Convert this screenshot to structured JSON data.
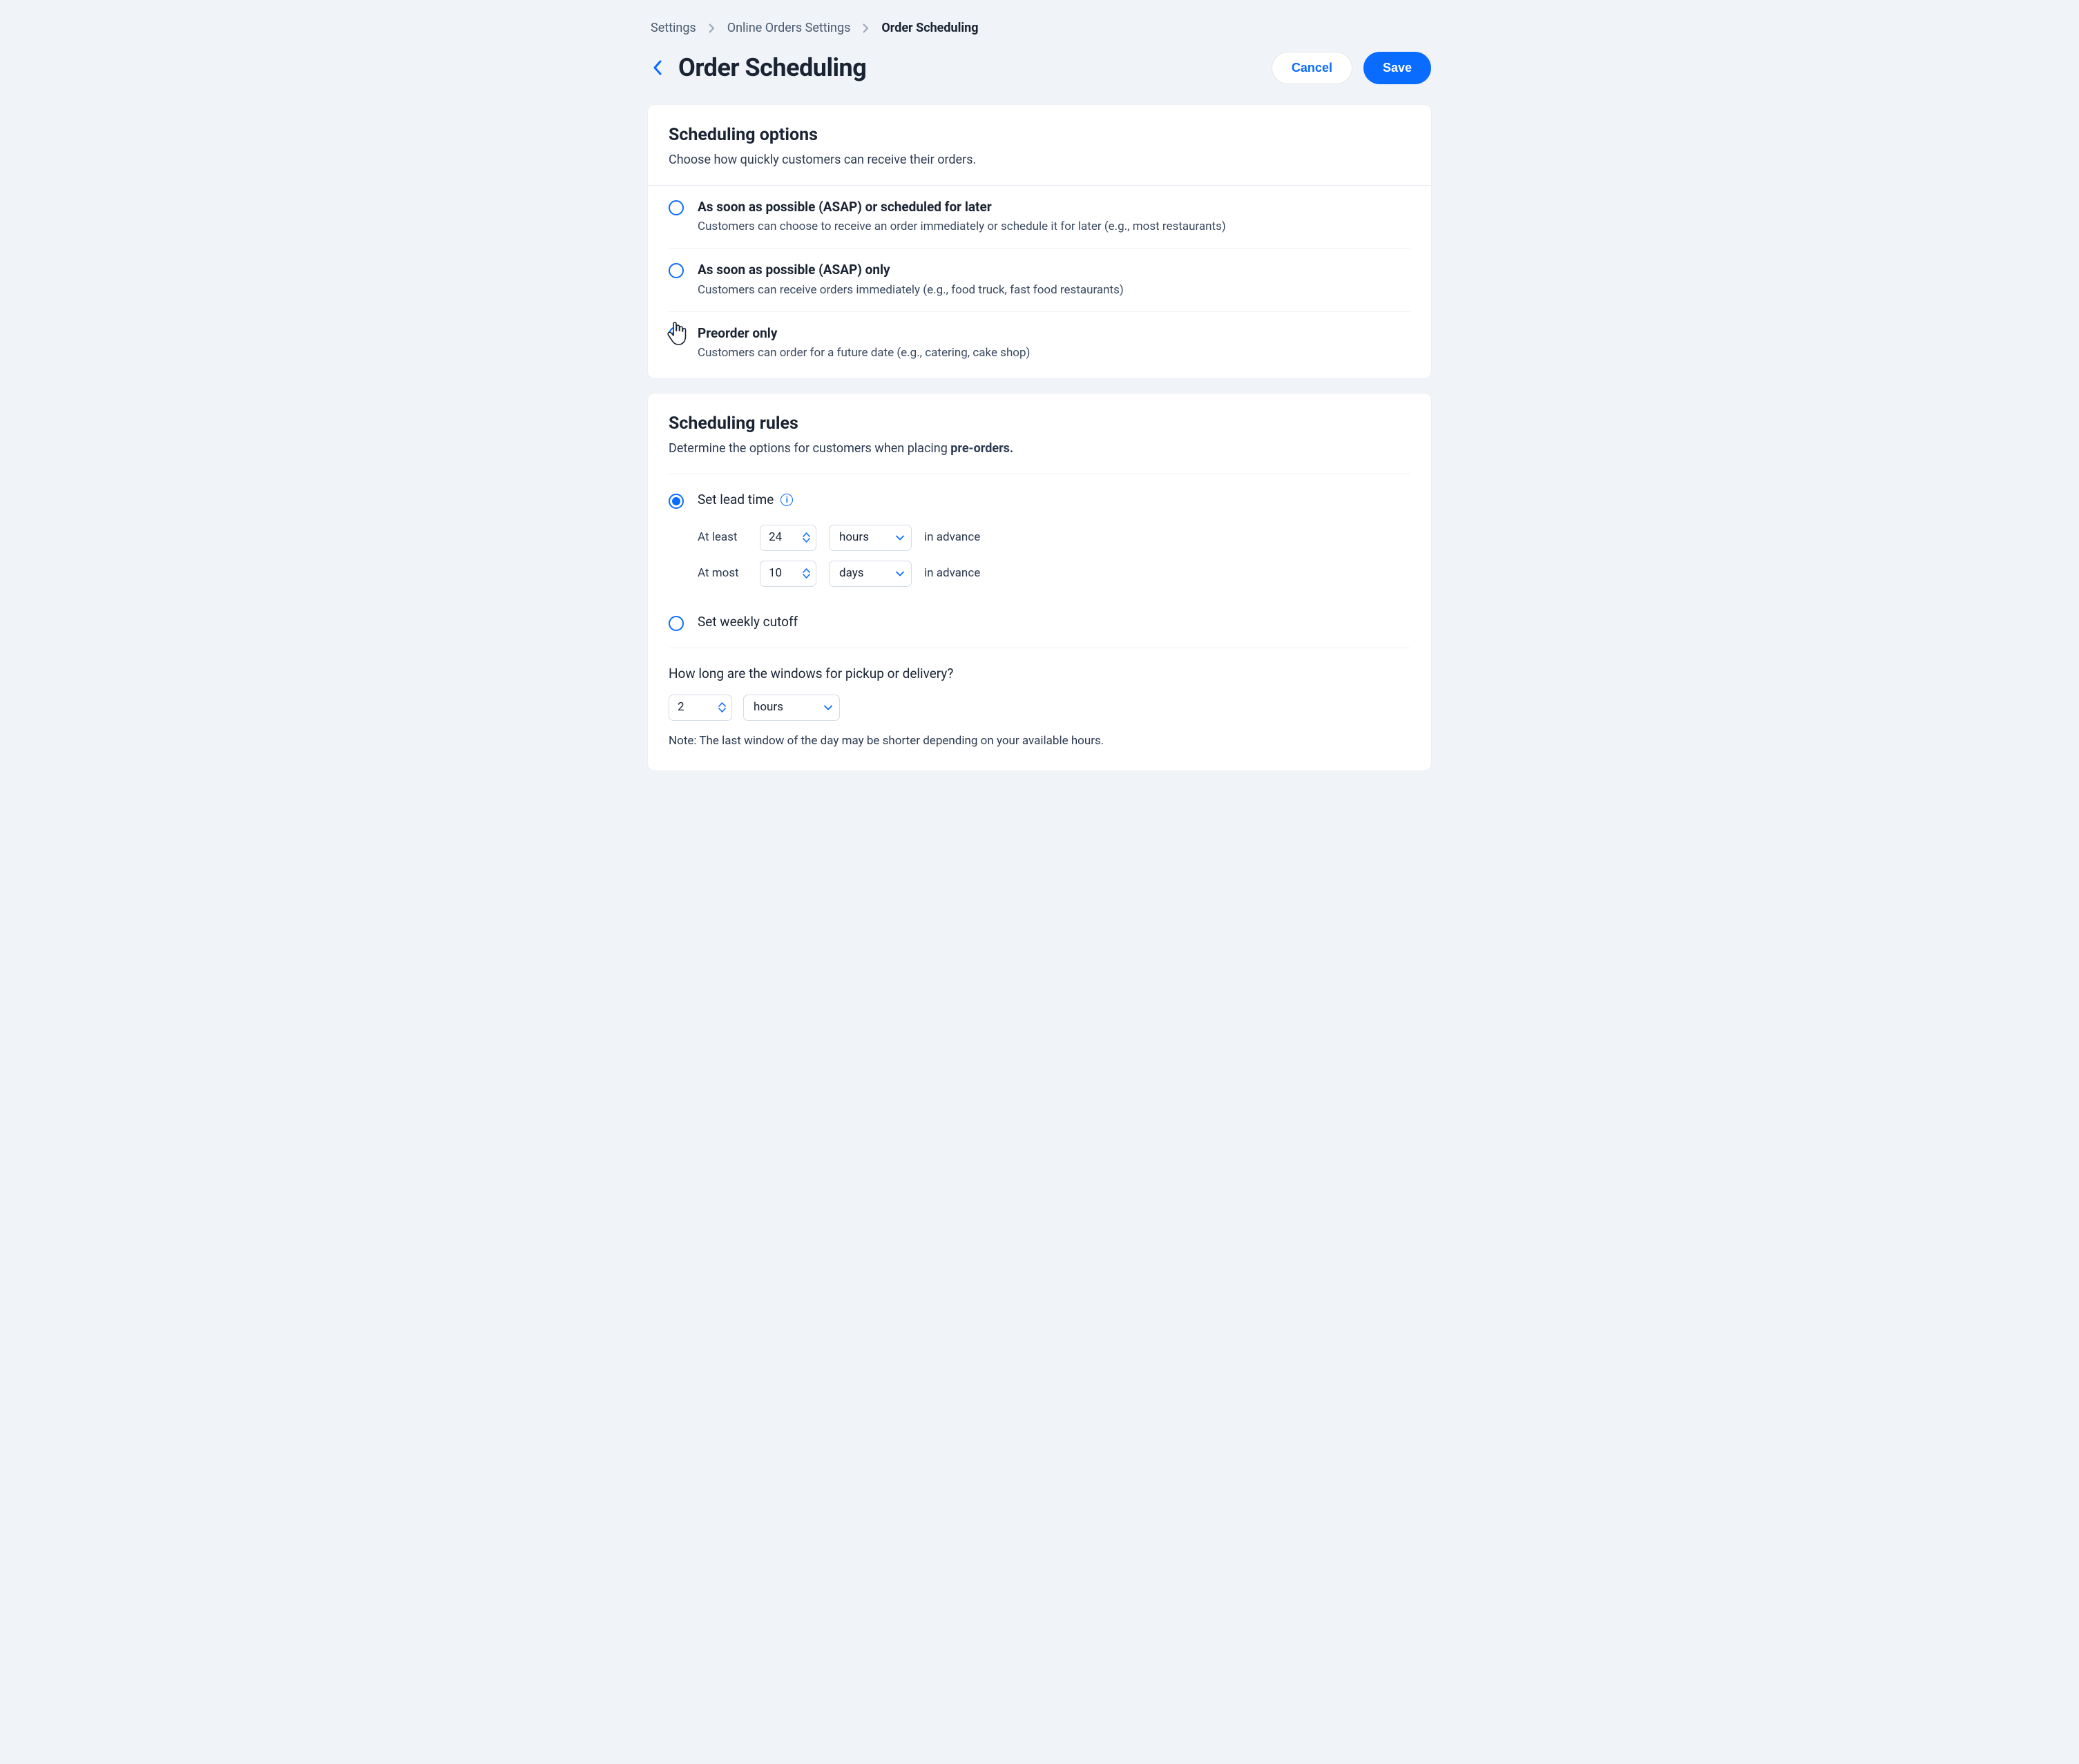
{
  "breadcrumbs": {
    "item0": "Settings",
    "item1": "Online Orders Settings",
    "item2": "Order Scheduling"
  },
  "page": {
    "title": "Order Scheduling",
    "cancel": "Cancel",
    "save": "Save"
  },
  "scheduling_options": {
    "title": "Scheduling options",
    "subtitle": "Choose how quickly customers can receive their orders.",
    "opt1_title": "As soon as possible (ASAP) or scheduled for later",
    "opt1_desc": "Customers can choose to receive an order immediately or schedule it for later (e.g., most restaurants)",
    "opt2_title": "As soon as possible (ASAP)  only",
    "opt2_desc": "Customers can receive orders immediately (e.g., food truck, fast food restaurants)",
    "opt3_title": "Preorder only",
    "opt3_desc": "Customers can order for a future date (e.g., catering, cake shop)"
  },
  "scheduling_rules": {
    "title": "Scheduling rules",
    "subtitle_prefix": "Determine the options for customers when placing ",
    "subtitle_strong": "pre-orders.",
    "lead_time_label": "Set lead time",
    "at_least_label": "At least",
    "at_least_value": "24",
    "at_least_unit": "hours",
    "at_most_label": "At most",
    "at_most_value": "10",
    "at_most_unit": "days",
    "in_advance": "in advance",
    "weekly_cutoff_label": "Set weekly cutoff",
    "window_question": "How long are the windows for pickup or delivery?",
    "window_value": "2",
    "window_unit": "hours",
    "note": "Note: The last window of the day may be shorter depending on your available hours."
  }
}
